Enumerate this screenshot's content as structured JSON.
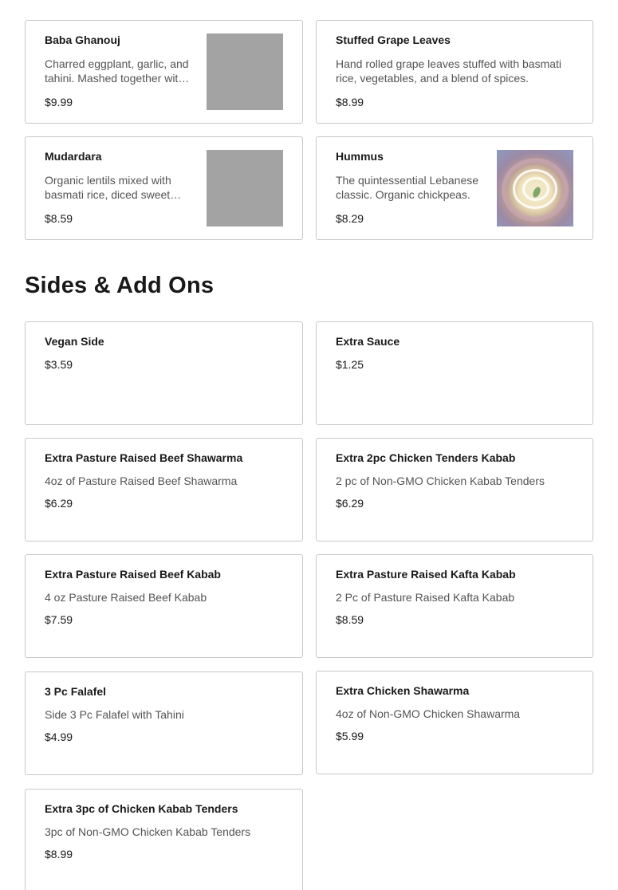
{
  "menu_top": [
    {
      "name": "Baba Ghanouj",
      "description": "Charred eggplant, garlic, and tahini. Mashed together with spices.",
      "price": "$9.99"
    },
    {
      "name": "Stuffed Grape Leaves",
      "description": "Hand rolled grape leaves stuffed with basmati rice, vegetables, and a blend of spices.",
      "price": "$8.99"
    },
    {
      "name": "Mudardara",
      "description": "Organic lentils mixed with basmati rice, diced sweet onions.",
      "price": "$8.59"
    },
    {
      "name": "Hummus",
      "description": "The quintessential Lebanese classic. Organic chickpeas.",
      "price": "$8.29"
    }
  ],
  "section": {
    "title": "Sides & Add Ons"
  },
  "sides": [
    {
      "name": "Vegan Side",
      "description": "",
      "price": "$3.59"
    },
    {
      "name": "Extra Sauce",
      "description": "",
      "price": "$1.25"
    },
    {
      "name": "Extra Pasture Raised Beef Shawarma",
      "description": "4oz of Pasture Raised Beef Shawarma",
      "price": "$6.29"
    },
    {
      "name": "Extra 2pc Chicken Tenders Kabab",
      "description": "2 pc of Non-GMO Chicken Kabab Tenders",
      "price": "$6.29"
    },
    {
      "name": "Extra Pasture Raised Beef Kabab",
      "description": "4 oz Pasture Raised Beef Kabab",
      "price": "$7.59"
    },
    {
      "name": "Extra Pasture Raised Kafta Kabab",
      "description": "2 Pc of Pasture Raised Kafta Kabab",
      "price": "$8.59"
    },
    {
      "name": "3 Pc Falafel",
      "description": "Side 3 Pc Falafel with Tahini",
      "price": "$4.99"
    },
    {
      "name": "Extra Chicken Shawarma",
      "description": "4oz of Non-GMO Chicken Shawarma",
      "price": "$5.99"
    },
    {
      "name": "Extra 3pc of Chicken Kabab Tenders",
      "description": "3pc of Non-GMO Chicken Kabab Tenders",
      "price": "$8.99"
    }
  ],
  "colors": {
    "card_border": "#c7c7c7",
    "placeholder_image": "#a3a3a3",
    "description_text": "#545454",
    "title_text": "#191919"
  },
  "icons": {
    "hummus_image": "hummus-photo",
    "placeholder_image": "image-placeholder"
  }
}
